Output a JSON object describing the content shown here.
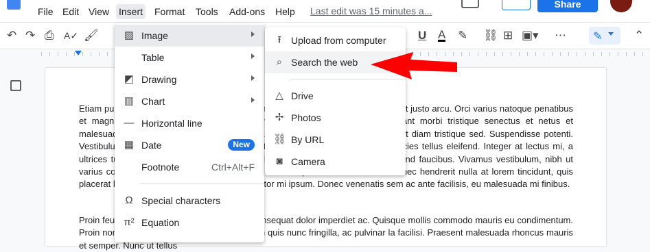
{
  "menubar": {
    "items": [
      "File",
      "Edit",
      "View",
      "Insert",
      "Format",
      "Tools",
      "Add-ons",
      "Help"
    ],
    "last_edit": "Last edit was 15 minutes a...",
    "share_label": "Share"
  },
  "document": {
    "paragraph1": "Etiam pulvinar, nulla a molestie tristique, arcu neque auctor dolor. Vivamus sit amet justo arcu. Orci varius natoque penatibus et magnis dis parturient montes, nascetur ridiculus mus. Pellentesque habitant morbi tristique senectus et netus et malesuada fames ac turpis egestas. Nam a ante lacinia sapien ipsum, eu aliquet diam tristique sed. Suspendisse potenti. Vestibulum ante ipsum primis in faucibus auctor lacus vel sem laoreet, sed ultricies tellus eleifend. Integer at lectus mi, a ultrices turpis. Fusce dignissim arcu sed. Nullam nec risus sit amet lorem eleifend faucibus. Vivamus vestibulum, nibh ut varius convallis, nunc tellus ornare ris nisi, eu ullamcorper dui tincidunt nec. Donec hendrerit nulla at lorem tincidunt, quis placerat lacus faucibus sit amet. Quisque porttitor mi ipsum. Donec venenatis sem ac ante facilisis, eu malesuada mi finibus.",
    "paragraph2": "Proin feugiat metus in sapien accumsan, in consequat dolor imperdiet ac. Quisque mollis commodo mauris eu condimentum. Proin non ultricies felis. Morbi consequat lorem quis nunc fringilla, ac pulvinar la facilisi. Praesent malesuada rhoncus mauris et semper. Nunc ut tellus"
  },
  "insert_menu": {
    "items": [
      {
        "icon": "image-icon",
        "label": "Image",
        "submenu": true
      },
      {
        "icon": "",
        "label": "Table",
        "submenu": true
      },
      {
        "icon": "drawing-icon",
        "label": "Drawing",
        "submenu": true
      },
      {
        "icon": "chart-icon",
        "label": "Chart",
        "submenu": true
      },
      {
        "icon": "horizontal-line-icon",
        "label": "Horizontal line"
      },
      {
        "icon": "date-icon",
        "label": "Date",
        "badge": "New"
      },
      {
        "icon": "",
        "label": "Footnote",
        "shortcut": "Ctrl+Alt+F"
      },
      {
        "icon": "omega-icon",
        "label": "Special characters"
      },
      {
        "icon": "pi-icon",
        "label": "Equation"
      }
    ]
  },
  "image_submenu": {
    "items": [
      {
        "icon": "upload-icon",
        "label": "Upload from computer"
      },
      {
        "icon": "search-icon",
        "label": "Search the web"
      },
      {
        "icon": "drive-icon",
        "label": "Drive"
      },
      {
        "icon": "photos-icon",
        "label": "Photos"
      },
      {
        "icon": "link-icon",
        "label": "By URL"
      },
      {
        "icon": "camera-icon",
        "label": "Camera"
      }
    ]
  },
  "colors": {
    "accent": "#1a73e8",
    "arrow": "#ff0000"
  }
}
